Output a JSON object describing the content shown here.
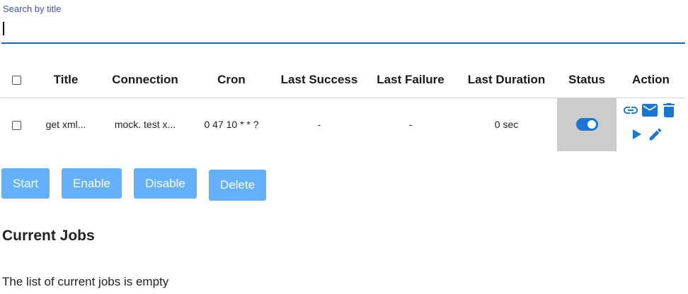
{
  "search": {
    "label": "Search by title",
    "value": "",
    "placeholder": ""
  },
  "table": {
    "headers": {
      "select": "",
      "title": "Title",
      "connection": "Connection",
      "cron": "Cron",
      "last_success": "Last Success",
      "last_failure": "Last Failure",
      "last_duration": "Last Duration",
      "status": "Status",
      "action": "Action"
    },
    "rows": [
      {
        "selected": false,
        "title": "get xml...",
        "connection": "mock. test x...",
        "cron": "0 47 10 * * ?",
        "last_success": "-",
        "last_failure": "-",
        "last_duration": "0 sec",
        "status_enabled": true,
        "actions": [
          "link-icon",
          "mail-icon",
          "delete-icon",
          "play-icon",
          "edit-icon"
        ]
      }
    ]
  },
  "buttons": {
    "start": "Start",
    "enable": "Enable",
    "disable": "Disable",
    "delete": "Delete"
  },
  "current_jobs": {
    "title": "Current Jobs",
    "empty_message": "The list of current jobs is empty"
  },
  "colors": {
    "accent": "#1565c0",
    "icon_blue": "#1976d2",
    "button_bg": "#64b0fa",
    "status_cell_bg": "#cccccc",
    "label_color": "#3f51b5"
  }
}
